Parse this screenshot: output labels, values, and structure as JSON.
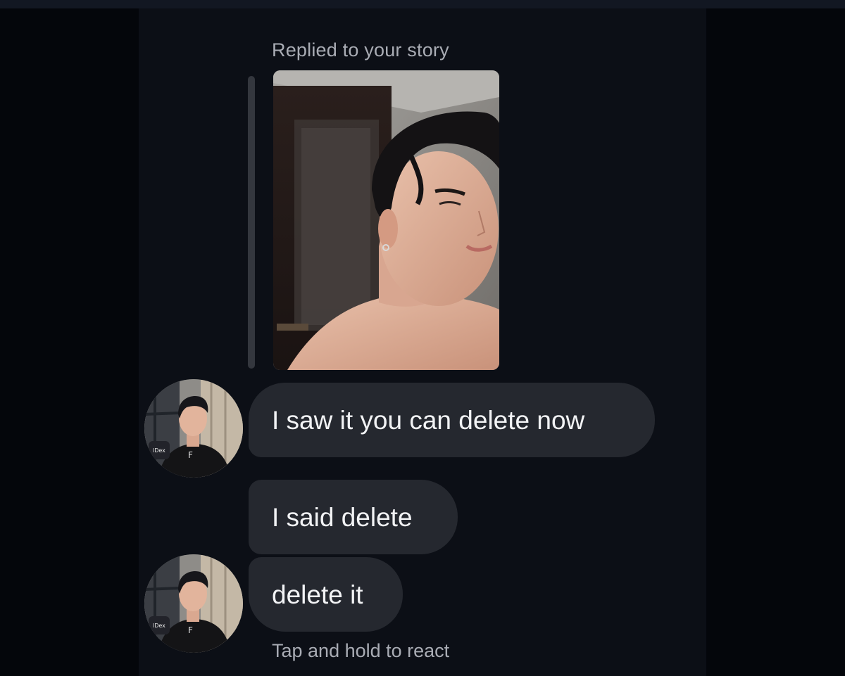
{
  "story_reply": {
    "label": "Replied to your story",
    "thumbnail_icon": "story-photo"
  },
  "messages": [
    {
      "text": "I saw it you can delete now",
      "sender": "other"
    },
    {
      "text": "I said delete",
      "sender": "other"
    },
    {
      "text": "delete it",
      "sender": "other"
    }
  ],
  "hint": "Tap and hold to react",
  "colors": {
    "background": "#04060b",
    "panel": "#0c0f16",
    "bubble": "#25282f",
    "bubble_text": "#f2f3f5",
    "meta_text": "#a9acb4"
  }
}
